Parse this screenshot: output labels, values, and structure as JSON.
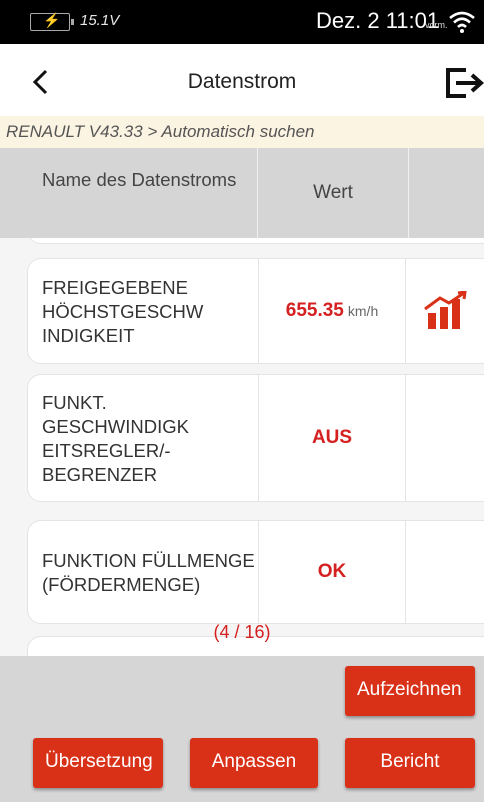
{
  "status_bar": {
    "voltage": "15.1V",
    "date_time": "Dez. 2 11:01",
    "am_pm": "vorm."
  },
  "header": {
    "title": "Datenstrom"
  },
  "breadcrumb": "RENAULT V43.33 > Automatisch suchen",
  "table": {
    "columns": [
      "Name des Datenstroms",
      "Wert",
      ""
    ],
    "rows": [
      {
        "name": "FREIGEGEBENE HÖCHSTGESCHW INDIGKEIT",
        "value": "655.35",
        "unit": "km/h",
        "graph": true
      },
      {
        "name": "FUNKT. GESCHWINDIGK EITSREGLER/- BEGRENZER",
        "value": "AUS",
        "unit": "",
        "graph": false
      },
      {
        "name": "FUNKTION FÜLLMENGE (FÖRDERMENGE)",
        "value": "OK",
        "unit": "",
        "graph": false
      }
    ],
    "pager": "(4 / 16)"
  },
  "buttons": {
    "record": "Aufzeichnen",
    "translate": "Übersetzung",
    "customize": "Anpassen",
    "report": "Bericht"
  },
  "colors": {
    "accent": "#d93018",
    "value_red": "#d42020",
    "breadcrumb_bg": "#fcf4e3",
    "header_bg": "#d5d5d5"
  }
}
